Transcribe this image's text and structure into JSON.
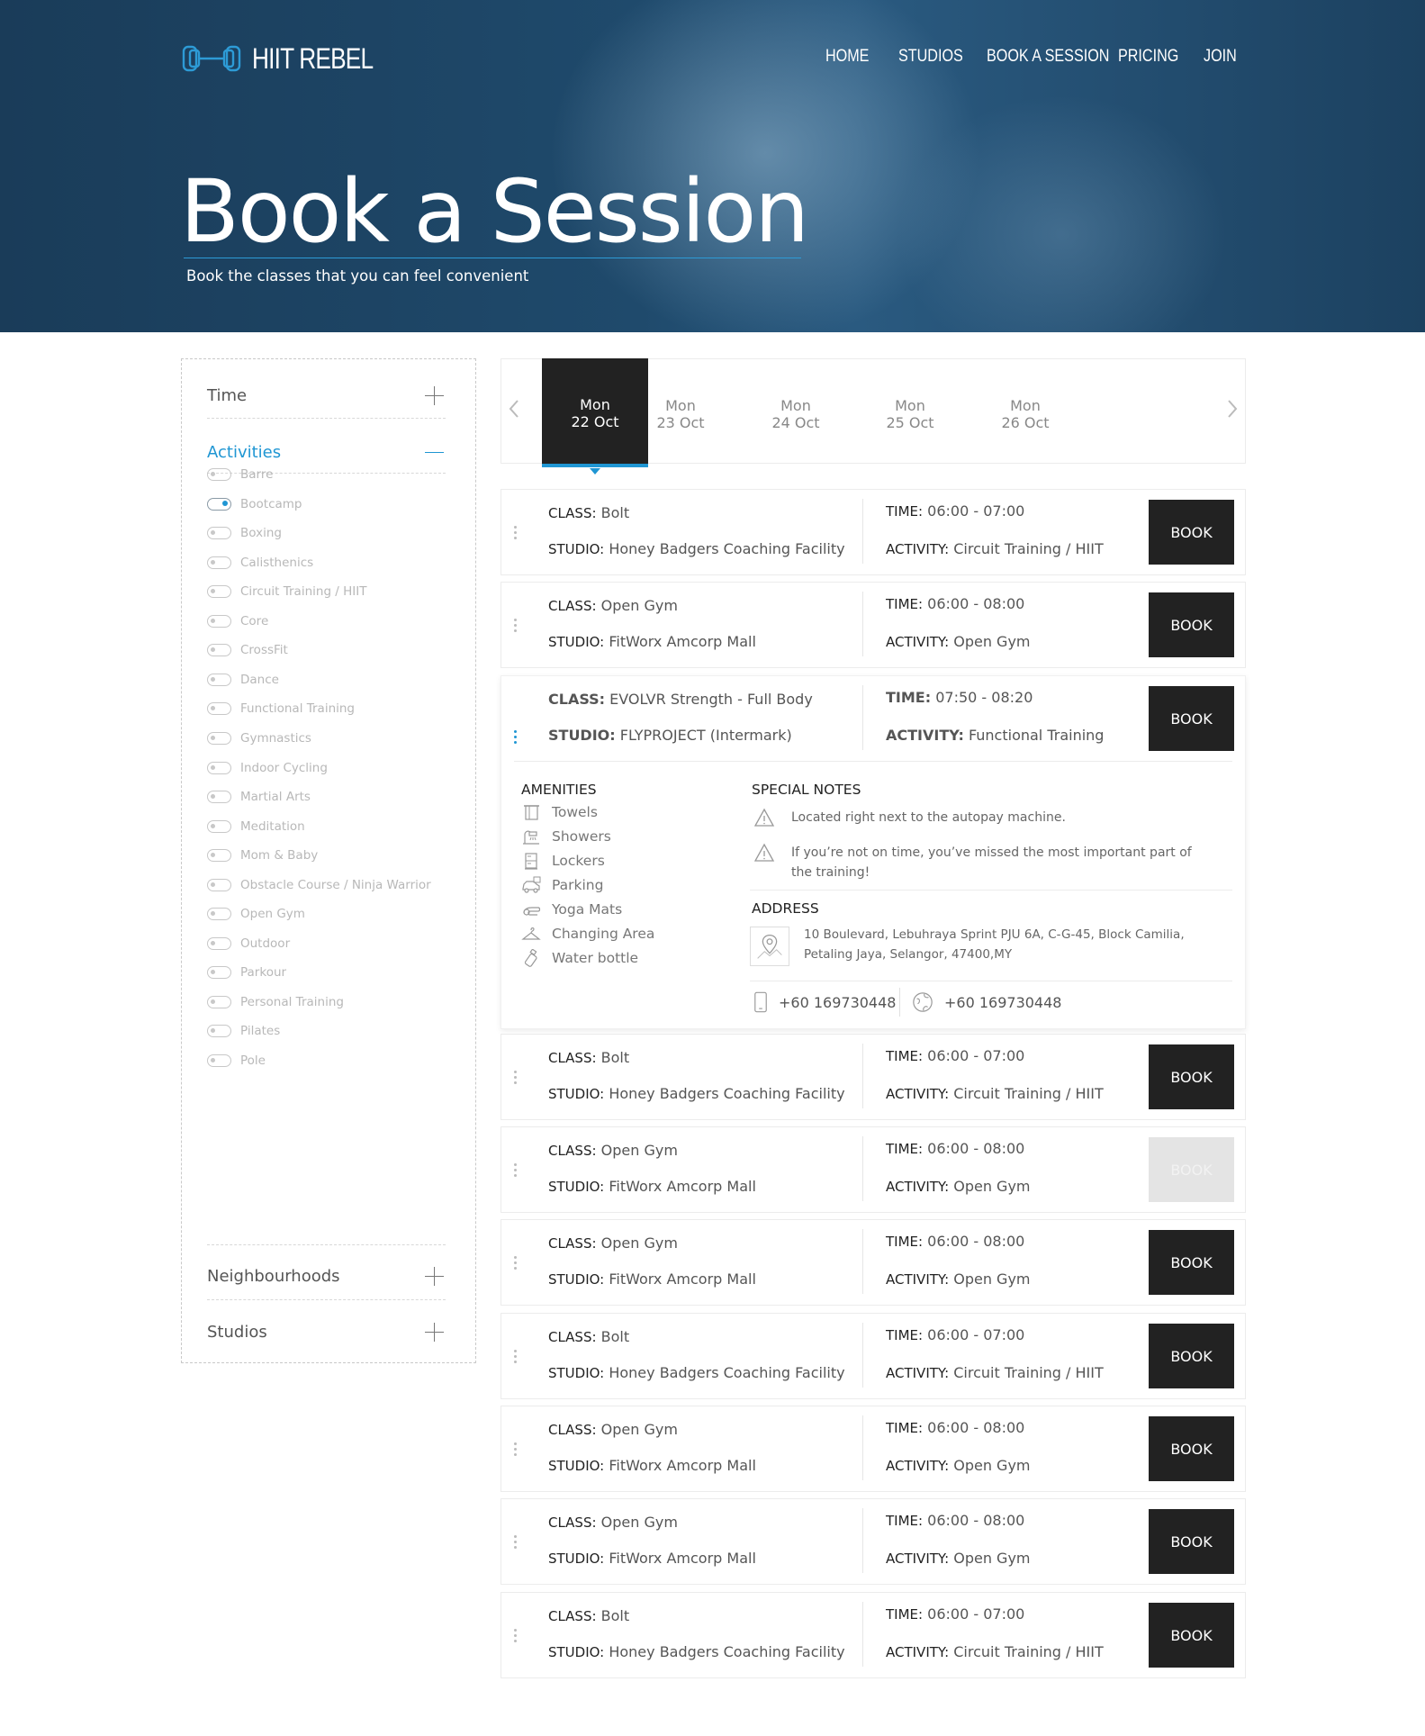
{
  "brand": {
    "name": "HIIT REBEL"
  },
  "nav": [
    "HOME",
    "STUDIOS",
    "BOOK A SESSION",
    "PRICING",
    "JOIN"
  ],
  "hero": {
    "title": "Book a Session",
    "subtitle": "Book the classes that you can feel convenient"
  },
  "filters": {
    "time": "Time",
    "activities": "Activities",
    "neighbourhoods": "Neighbourhoods",
    "studios": "Studios",
    "activity_list": [
      "Barre",
      "Bootcamp",
      "Boxing",
      "Calisthenics",
      "Circuit Training / HIIT",
      "Core",
      "CrossFit",
      "Dance",
      "Functional Training",
      "Gymnastics",
      "Indoor Cycling",
      "Martial Arts",
      "Meditation",
      "Mom & Baby",
      "Obstacle Course / Ninja Warrior",
      "Open Gym",
      "Outdoor",
      "Parkour",
      "Personal Training",
      "Pilates",
      "Pole"
    ],
    "selected_activity": "Bootcamp"
  },
  "dates": [
    {
      "day": "Mon",
      "date": "22 Oct",
      "active": true
    },
    {
      "day": "Mon",
      "date": "23 Oct"
    },
    {
      "day": "Mon",
      "date": "24 Oct"
    },
    {
      "day": "Mon",
      "date": "25 Oct"
    },
    {
      "day": "Mon",
      "date": "26 Oct"
    }
  ],
  "labels": {
    "class": "CLASS:",
    "studio": "STUDIO:",
    "time": "TIME:",
    "activity": "ACTIVITY:",
    "book": "BOOK"
  },
  "sessions": [
    {
      "class": "Bolt",
      "studio": "Honey Badgers Coaching Facility",
      "time": "06:00 - 07:00",
      "activity": "Circuit Training / HIIT"
    },
    {
      "class": "Open Gym",
      "studio": "FitWorx Amcorp Mall",
      "time": "06:00 - 08:00",
      "activity": "Open Gym"
    },
    {
      "class": "EVOLVR Strength - Full Body",
      "studio": "FLYPROJECT (Intermark)",
      "time": "07:50 - 08:20",
      "activity": "Functional Training",
      "expanded": true
    },
    {
      "class": "Bolt",
      "studio": "Honey Badgers Coaching Facility",
      "time": "06:00 - 07:00",
      "activity": "Circuit Training / HIIT"
    },
    {
      "class": "Open Gym",
      "studio": "FitWorx Amcorp Mall",
      "time": "06:00 - 08:00",
      "activity": "Open Gym",
      "disabled": true
    },
    {
      "class": "Open Gym",
      "studio": "FitWorx Amcorp Mall",
      "time": "06:00 - 08:00",
      "activity": "Open Gym"
    },
    {
      "class": "Bolt",
      "studio": "Honey Badgers Coaching Facility",
      "time": "06:00 - 07:00",
      "activity": "Circuit Training / HIIT"
    },
    {
      "class": "Open Gym",
      "studio": "FitWorx Amcorp Mall",
      "time": "06:00 - 08:00",
      "activity": "Open Gym"
    },
    {
      "class": "Open Gym",
      "studio": "FitWorx Amcorp Mall",
      "time": "06:00 - 08:00",
      "activity": "Open Gym"
    },
    {
      "class": "Bolt",
      "studio": "Honey Badgers Coaching Facility",
      "time": "06:00 - 07:00",
      "activity": "Circuit Training / HIIT"
    }
  ],
  "details": {
    "amenities_title": "AMENITIES",
    "amenities": [
      {
        "label": "Towels",
        "icon": "towel-icon"
      },
      {
        "label": "Showers",
        "icon": "shower-icon"
      },
      {
        "label": "Lockers",
        "icon": "locker-icon"
      },
      {
        "label": "Parking",
        "icon": "car-icon"
      },
      {
        "label": "Yoga Mats",
        "icon": "yoga-mat-icon"
      },
      {
        "label": "Changing Area",
        "icon": "hanger-icon"
      },
      {
        "label": "Water bottle",
        "icon": "bottle-icon"
      }
    ],
    "notes_title": "SPECIAL NOTES",
    "notes": [
      "Located right next to the autopay machine.",
      "If you’re not on time, you’ve missed the most important part of the training!"
    ],
    "address_title": "ADDRESS",
    "address": "10 Boulevard, Lebuhraya Sprint PJU 6A, C-G-45, Block Camilia, Petaling Jaya, Selangor, 47400,MY",
    "phone": "+60 169730448",
    "web": "+60 169730448"
  },
  "colors": {
    "accent": "#1f96d3",
    "dark": "#222222",
    "hero": "#1f4a6c"
  }
}
